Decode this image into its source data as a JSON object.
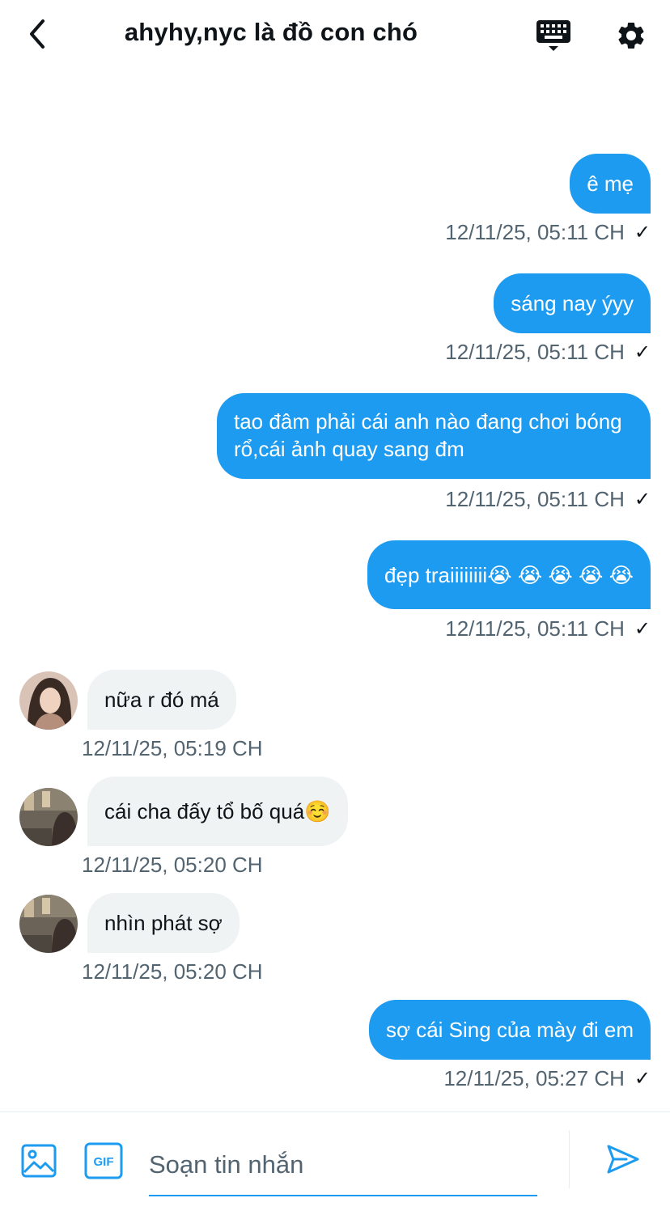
{
  "header": {
    "title": "ahyhy,nyc là đồ con chó"
  },
  "messages": [
    {
      "dir": "out",
      "text": "ê mẹ",
      "time": "12/11/25, 05:11 CH"
    },
    {
      "dir": "out",
      "text": "sáng nay ýyy",
      "time": "12/11/25, 05:11 CH"
    },
    {
      "dir": "out",
      "text": "tao đâm phải cái anh nào đang chơi bóng rổ,cái ảnh quay sang đm",
      "time": "12/11/25, 05:11 CH"
    },
    {
      "dir": "out",
      "text": "đẹp traiiiiiiii😭 😭 😭 😭 😭",
      "time": "12/11/25, 05:11 CH"
    },
    {
      "dir": "in",
      "text": "nữa r đó má",
      "time": "12/11/25, 05:19 CH"
    },
    {
      "dir": "in",
      "text": "cái cha đấy tổ bố quá☺️",
      "time": "12/11/25, 05:20 CH"
    },
    {
      "dir": "in",
      "text": "nhìn phát sợ",
      "time": "12/11/25, 05:20 CH"
    },
    {
      "dir": "out",
      "text": "sợ cái Sing của mày đi em",
      "time": "12/11/25, 05:27 CH"
    }
  ],
  "composer": {
    "placeholder": "Soạn tin nhắn",
    "gif_label": "GIF"
  },
  "icons": {
    "back": "back-arrow-icon",
    "keyboard": "keyboard-icon",
    "settings": "gear-icon",
    "media": "image-icon",
    "gif": "gif-icon",
    "send": "send-icon"
  },
  "colors": {
    "accent": "#1d9bf0",
    "incoming_bubble": "#eff3f4",
    "meta_text": "#536471"
  }
}
